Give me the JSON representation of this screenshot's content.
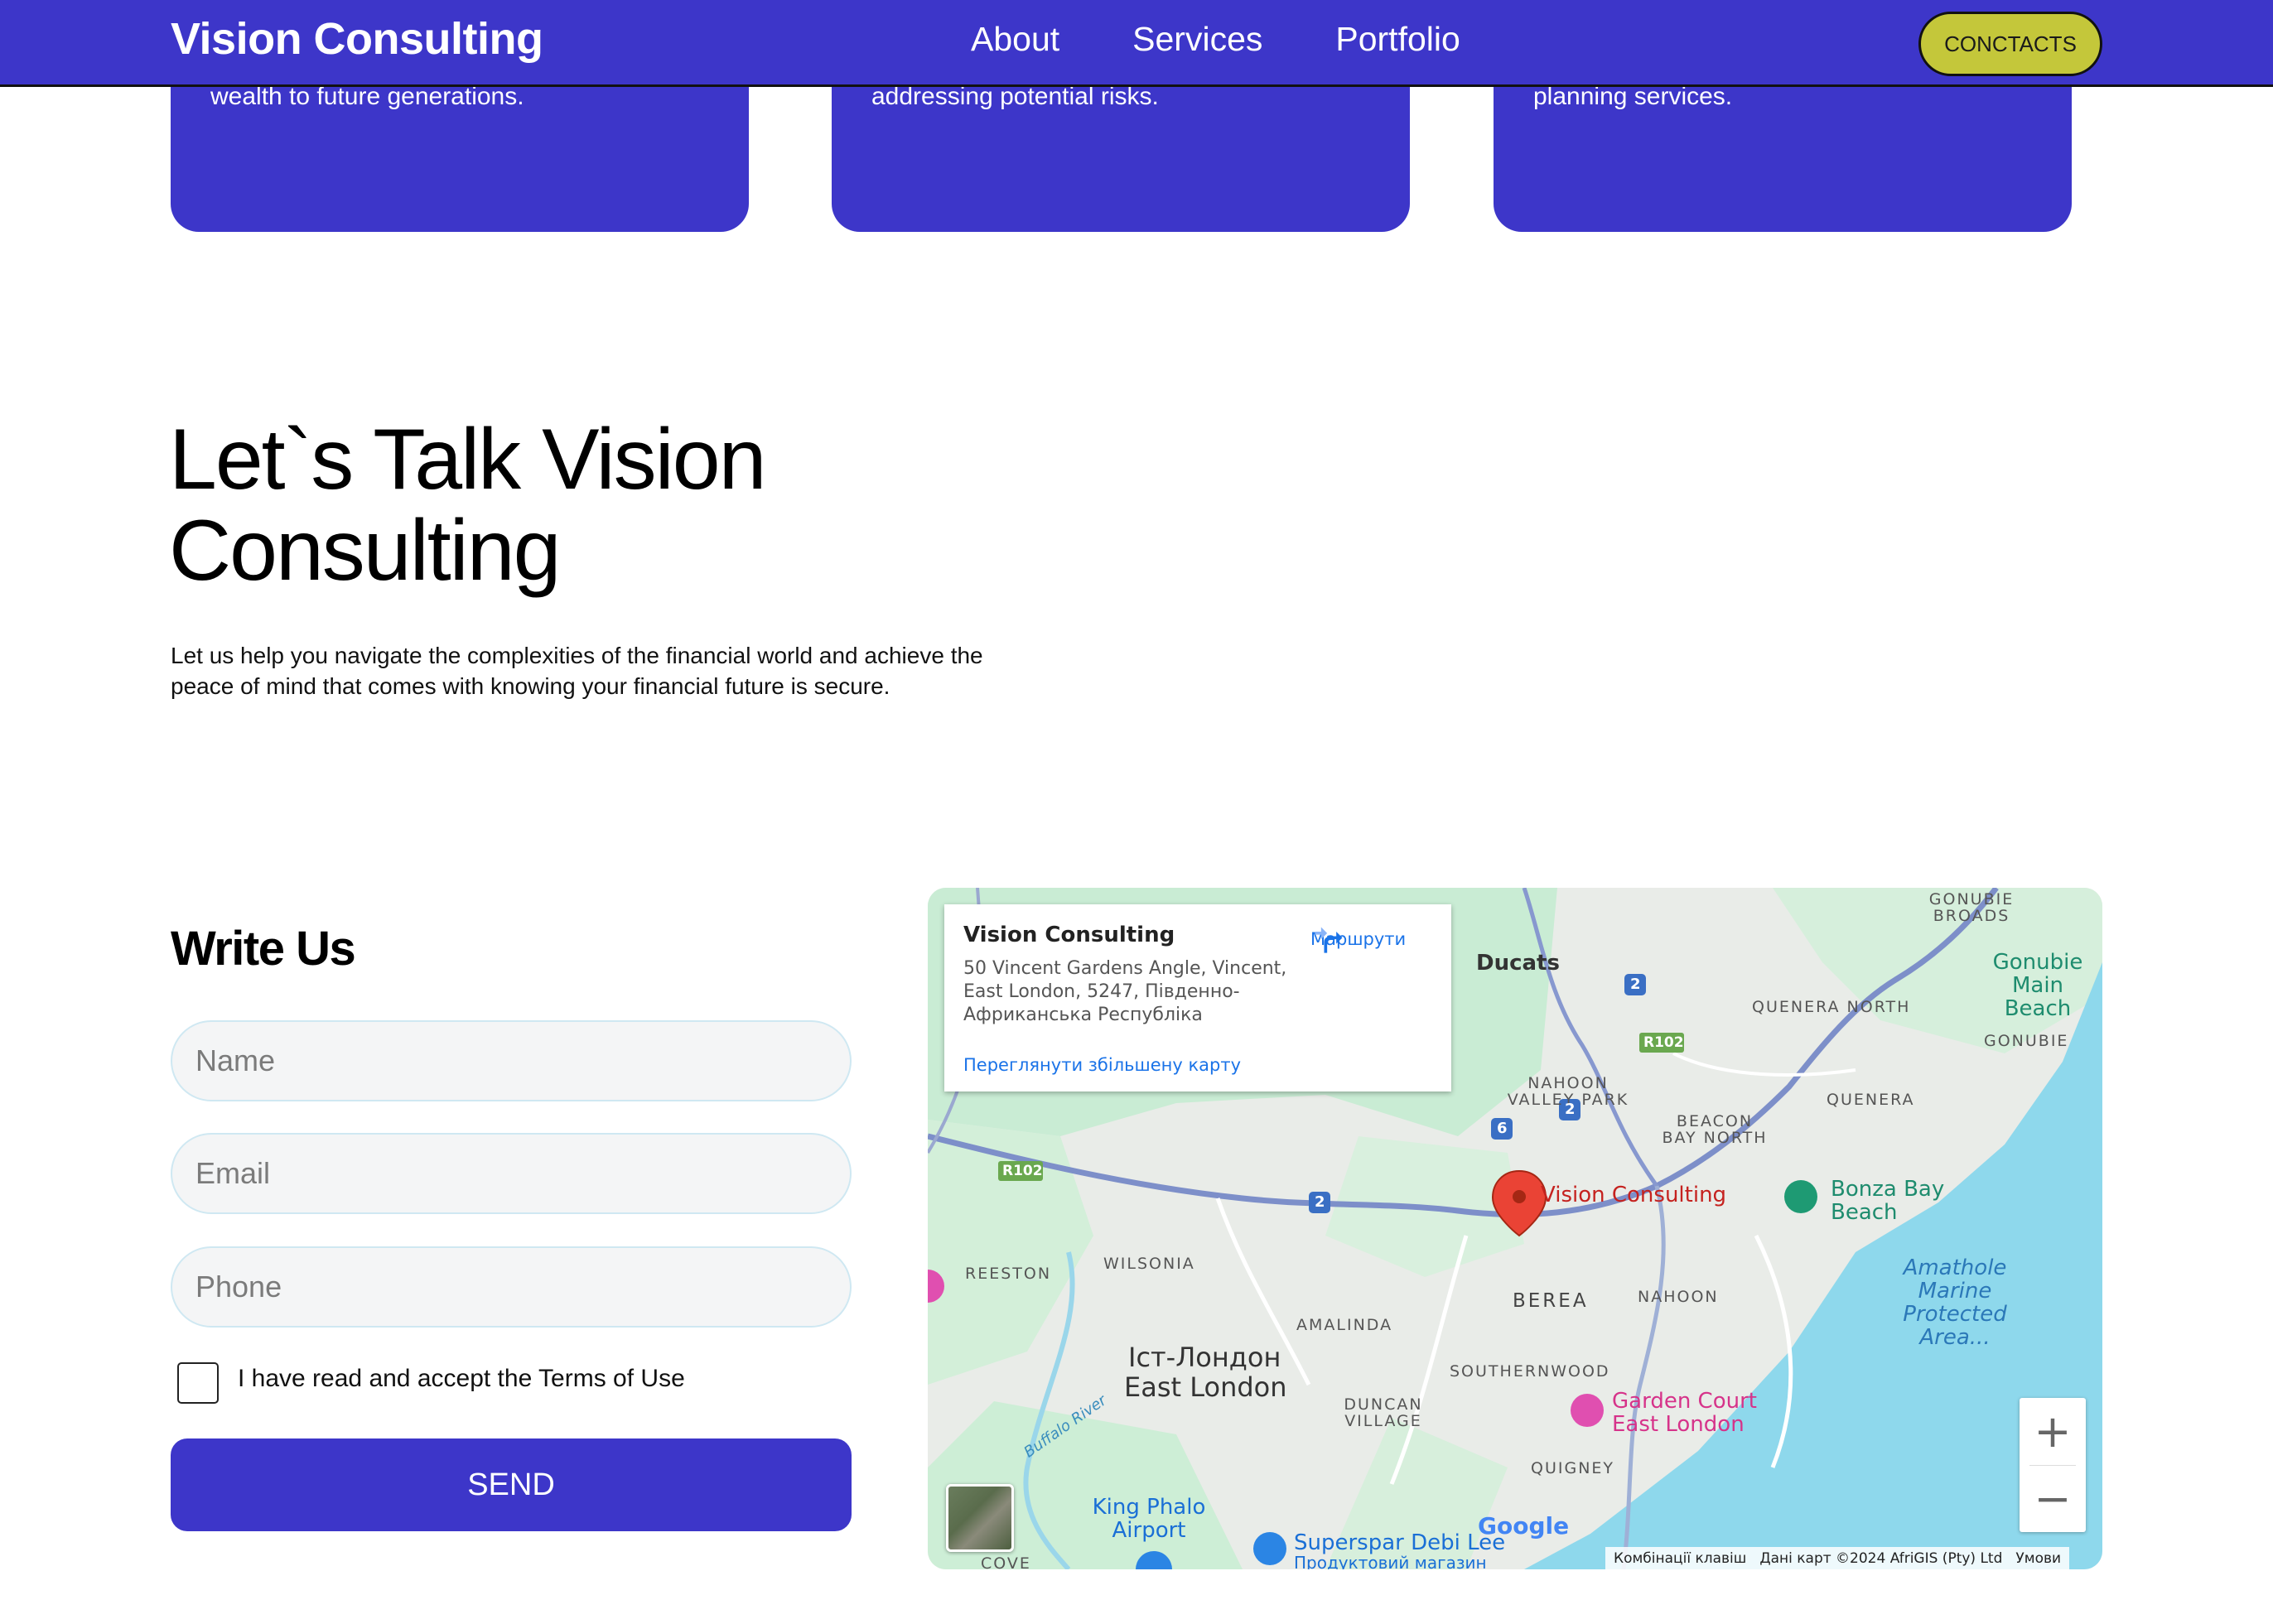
{
  "header": {
    "logo": "Vision Consulting",
    "nav": [
      "About",
      "Services",
      "Portfolio"
    ],
    "contacts_button": "CONCTACTS"
  },
  "cards": [
    {
      "text": "wealth to future generations."
    },
    {
      "text": "addressing potential risks."
    },
    {
      "text": "planning services."
    }
  ],
  "intro": {
    "headline_line1": "Let`s Talk Vision",
    "headline_line2": "Consulting",
    "lead": "Let us help you navigate the complexities of the financial world and achieve the peace of mind that comes with knowing your financial future is secure."
  },
  "form": {
    "title": "Write Us",
    "name_placeholder": "Name",
    "email_placeholder": "Email",
    "phone_placeholder": "Phone",
    "terms_label": "I have read and accept the Terms of Use",
    "send_label": "SEND"
  },
  "map": {
    "info": {
      "name": "Vision Consulting",
      "address": "50 Vincent Gardens Angle, Vincent, East London, 5247, Південно-Африканська Республіка",
      "directions": "Маршрути",
      "larger_map": "Переглянути збільшену карту"
    },
    "labels": {
      "ducats": "Ducats",
      "gonubie_broads": "GONUBIE BROADS",
      "gonubie_main_beach": "Gonubie Main Beach",
      "quenera_north": "QUENERA NORTH",
      "gonubie": "GONUBIE",
      "quenera": "QUENERA",
      "nahoon_valley_park": "NAHOON VALLEY PARK",
      "beacon_bay_north": "BEACON BAY NORTH",
      "bonza_bay_beach": "Bonza Bay Beach",
      "vision_consulting": "Vision Consulting",
      "reeston": "REESTON",
      "wilsonia": "WILSONIA",
      "berea": "BEREA",
      "nahoon": "NAHOON",
      "amathole": "Amathole Marine Protected Area...",
      "amalinda": "AMALINDA",
      "city_uk": "Іст-Лондон",
      "city_en": "East London",
      "southernwood": "SOUTHERNWOOD",
      "garden_court": "Garden Court East London",
      "buffalo_river": "Buffalo River",
      "duncan_village": "DUNCAN VILLAGE",
      "quigney": "QUIGNEY",
      "king_phalo": "King Phalo Airport",
      "superspar": "Superspar Debi Lee",
      "superspar_sub": "Продуктовий магазин",
      "cove": "COVE",
      "google": "Google",
      "r102": "R102",
      "route2": "2",
      "route6": "6"
    },
    "attribution": {
      "shortcuts": "Комбінації клавіш",
      "data": "Дані карт ©2024 AfriGIS (Pty) Ltd",
      "terms": "Умови"
    },
    "zoom_in": "+",
    "zoom_out": "−"
  }
}
